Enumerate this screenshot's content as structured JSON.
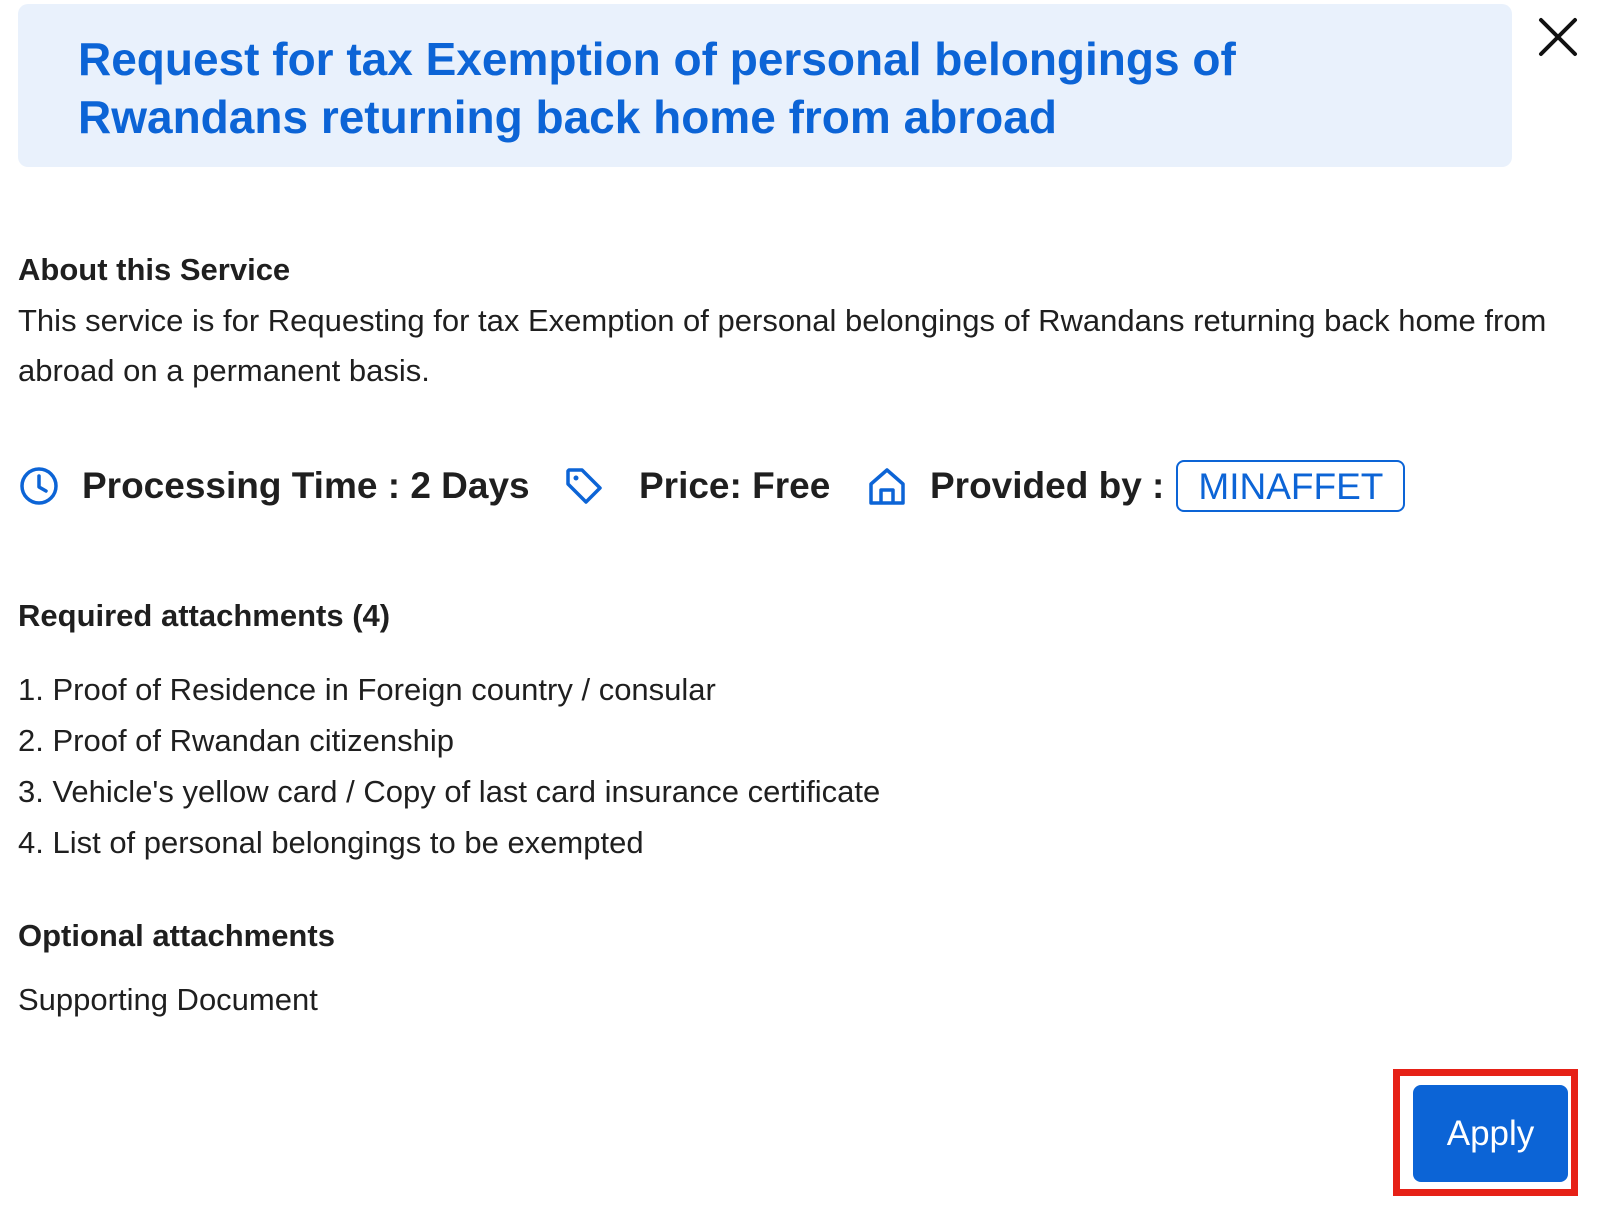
{
  "dialog": {
    "title": "Request for tax Exemption of personal belongings of Rwandans returning back home from abroad",
    "close_icon": "close-icon"
  },
  "about": {
    "heading": "About this Service",
    "description": "This service is for Requesting for tax Exemption of personal belongings of Rwandans returning back home from abroad on a permanent basis."
  },
  "meta": {
    "processing_time": "Processing Time : 2 Days",
    "price": "Price: Free",
    "provided_by_label": "Provided by :",
    "provider": "MINAFFET",
    "icons": [
      "clock-icon",
      "tag-icon",
      "home-icon"
    ],
    "icon_color": "#0c64d6"
  },
  "required": {
    "heading": "Required attachments (4)",
    "items": [
      "1. Proof of Residence in Foreign country / consular",
      "2. Proof of Rwandan citizenship",
      "3. Vehicle's yellow card / Copy of last card insurance certificate",
      "4. List of personal belongings to be exempted"
    ]
  },
  "optional": {
    "heading": "Optional attachments",
    "items": [
      "Supporting Document"
    ]
  },
  "actions": {
    "apply_label": "Apply"
  },
  "colors": {
    "accent": "#0c64d6",
    "banner_bg": "#e9f1fc",
    "highlight": "#e62117"
  }
}
